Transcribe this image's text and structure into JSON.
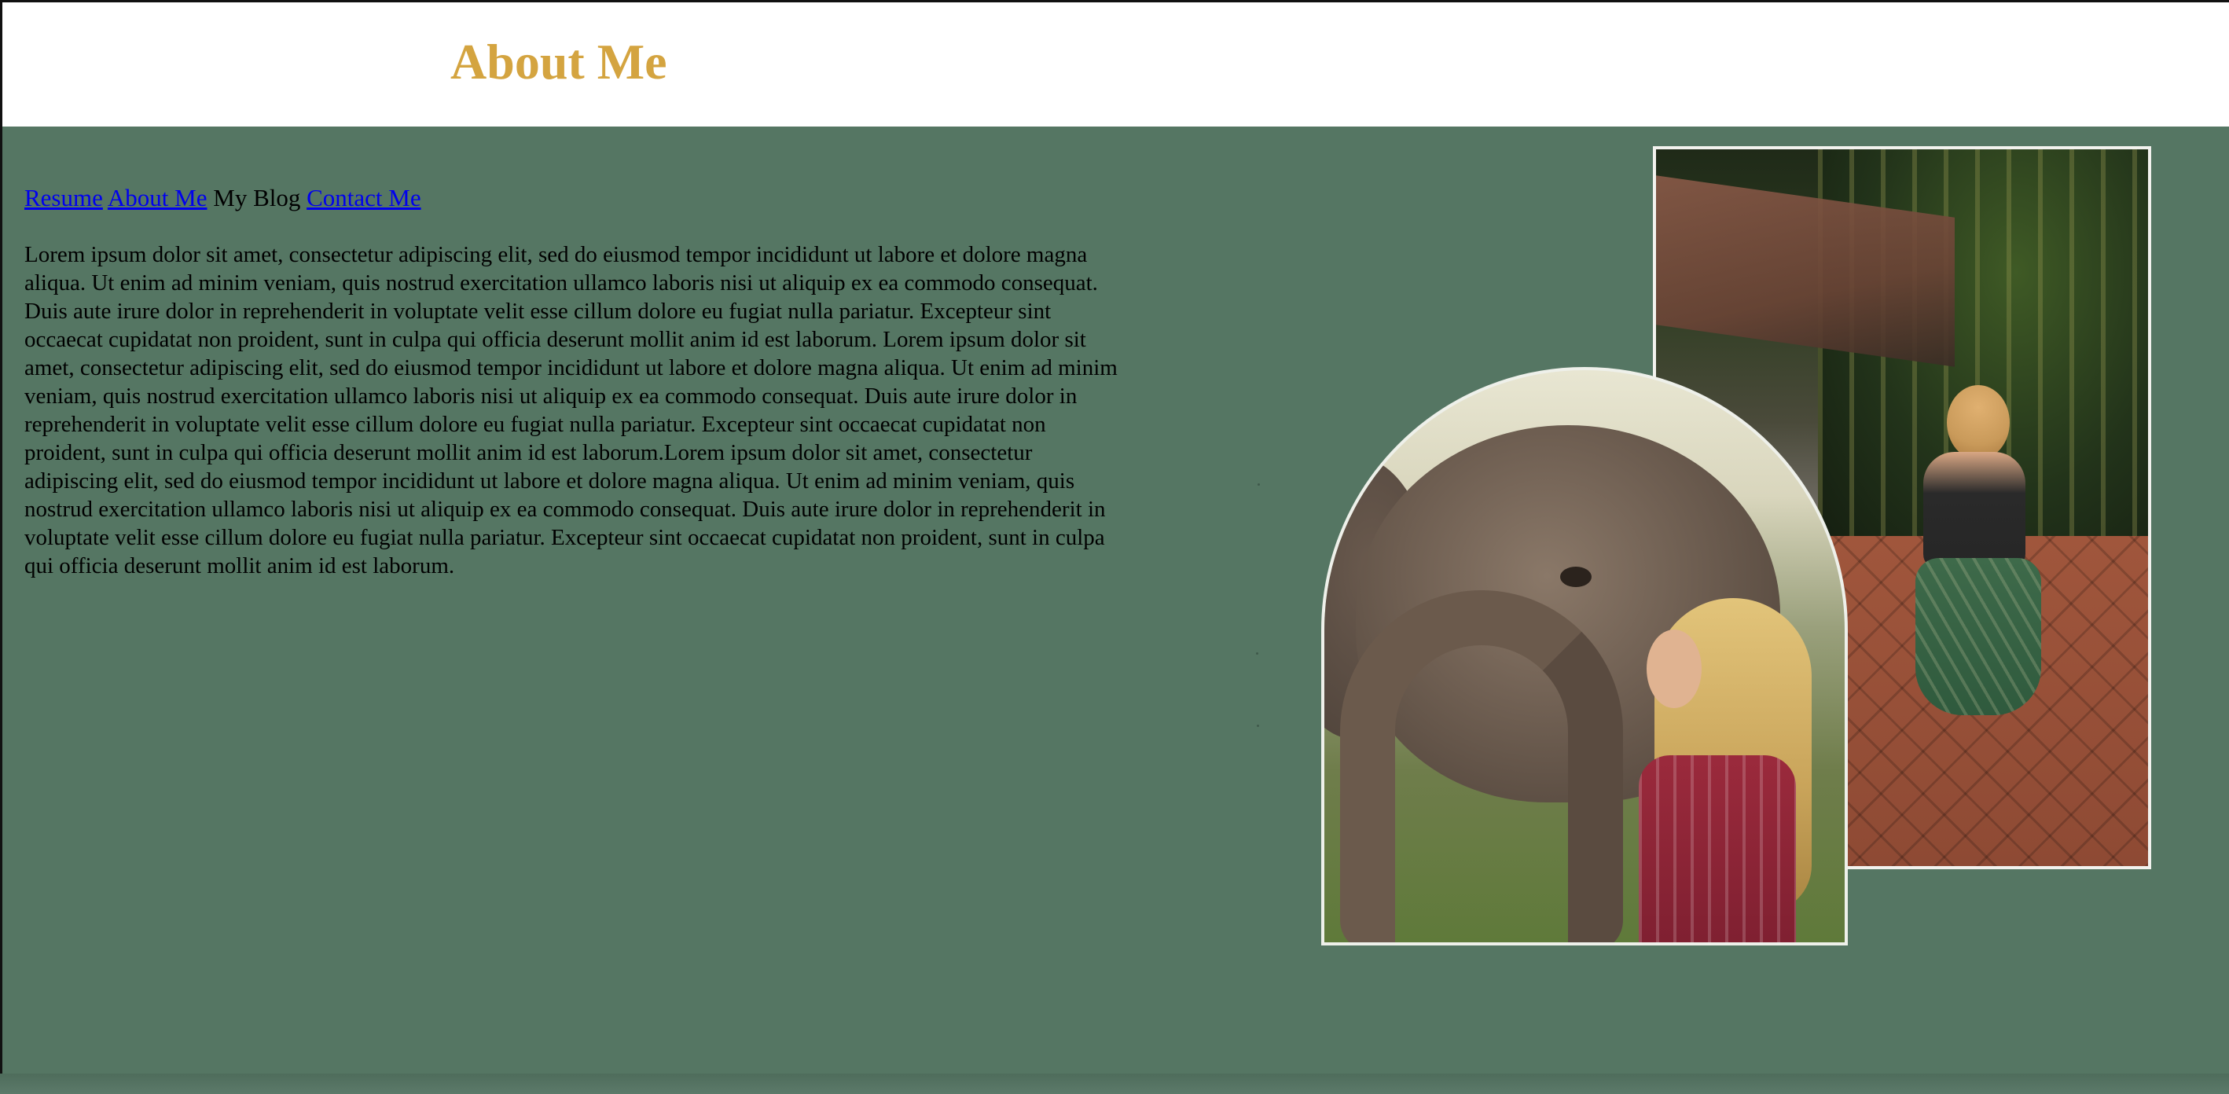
{
  "header": {
    "title": "About Me"
  },
  "nav": {
    "items": [
      {
        "label": "Resume",
        "link": true
      },
      {
        "label": "About Me",
        "link": true
      },
      {
        "label": "My Blog",
        "link": false
      },
      {
        "label": "Contact Me",
        "link": true
      }
    ]
  },
  "main": {
    "body_text": "Lorem ipsum dolor sit amet, consectetur adipiscing elit, sed do eiusmod tempor incididunt ut labore et dolore magna aliqua. Ut enim ad minim veniam, quis nostrud exercitation ullamco laboris nisi ut aliquip ex ea commodo consequat. Duis aute irure dolor in reprehenderit in voluptate velit esse cillum dolore eu fugiat nulla pariatur. Excepteur sint occaecat cupidatat non proident, sunt in culpa qui officia deserunt mollit anim id est laborum. Lorem ipsum dolor sit amet, consectetur adipiscing elit, sed do eiusmod tempor incididunt ut labore et dolore magna aliqua. Ut enim ad minim veniam, quis nostrud exercitation ullamco laboris nisi ut aliquip ex ea commodo consequat. Duis aute irure dolor in reprehenderit in voluptate velit esse cillum dolore eu fugiat nulla pariatur. Excepteur sint occaecat cupidatat non proident, sunt in culpa qui officia deserunt mollit anim id est laborum.Lorem ipsum dolor sit amet, consectetur adipiscing elit, sed do eiusmod tempor incididunt ut labore et dolore magna aliqua. Ut enim ad minim veniam, quis nostrud exercitation ullamco laboris nisi ut aliquip ex ea commodo consequat. Duis aute irure dolor in reprehenderit in voluptate velit esse cillum dolore eu fugiat nulla pariatur. Excepteur sint occaecat cupidatat non proident, sunt in culpa qui officia deserunt mollit anim id est laborum."
  },
  "colors": {
    "background": "#557663",
    "header_background": "#ffffff",
    "title": "#d4a440",
    "link": "#0000ee",
    "text": "#000000"
  },
  "images": {
    "market_photo": "woman-holding-puppy-photo",
    "elephant_photo": "woman-with-elephant-photo"
  }
}
